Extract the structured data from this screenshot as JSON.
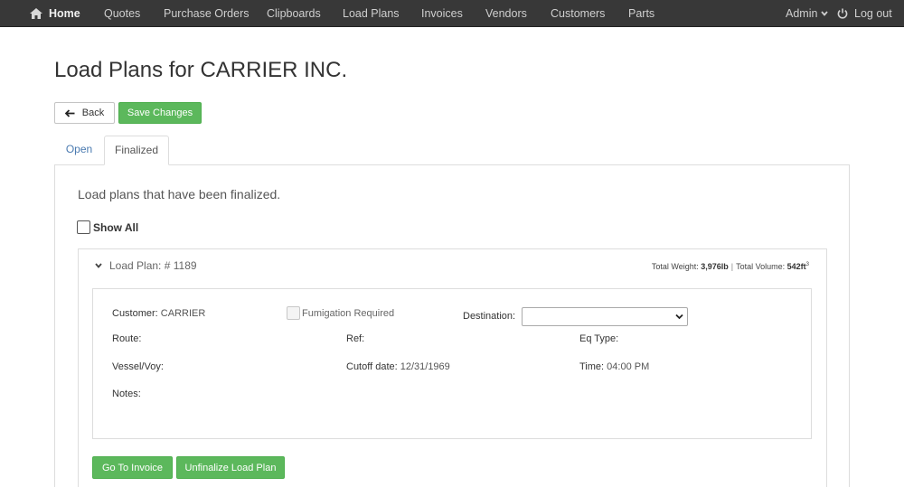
{
  "nav": {
    "home": "Home",
    "links": [
      "Quotes",
      "Purchase Orders",
      "Clipboards",
      "Load Plans",
      "Invoices",
      "Vendors",
      "Customers",
      "Parts"
    ],
    "admin": "Admin",
    "logout": "Log out"
  },
  "page": {
    "title": "Load Plans for CARRIER INC.",
    "back_label": "Back",
    "save_label": "Save Changes"
  },
  "tabs": [
    "Open",
    "Finalized"
  ],
  "panel": {
    "description": "Load plans that have been finalized.",
    "show_all_label": "Show All"
  },
  "load_plan": {
    "header_prefix": "Load Plan: # ",
    "number": "1189",
    "total_weight_label": "Total Weight: ",
    "total_weight": "3,976lb",
    "separator": "|",
    "total_volume_label": "Total Volume: ",
    "total_volume": "542ft",
    "volume_exp": "3",
    "customer_label": "Customer: ",
    "customer": "CARRIER",
    "fumigation_label": "Fumigation Required",
    "destination_label": "Destination:",
    "destination_value": "",
    "route_label": "Route:",
    "ref_label": "Ref:",
    "eq_type_label": "Eq Type:",
    "vessel_label": "Vessel/Voy:",
    "cutoff_label": "Cutoff date: ",
    "cutoff_date": "12/31/1969",
    "time_label": "Time: ",
    "time": "04:00 PM",
    "notes_label": "Notes:",
    "go_to_invoice_label": "Go To Invoice",
    "unfinalize_label": "Unfinalize Load Plan"
  },
  "colors": {
    "navbar": "#383838",
    "success": "#5cb85c",
    "link": "#4a7ab0"
  }
}
